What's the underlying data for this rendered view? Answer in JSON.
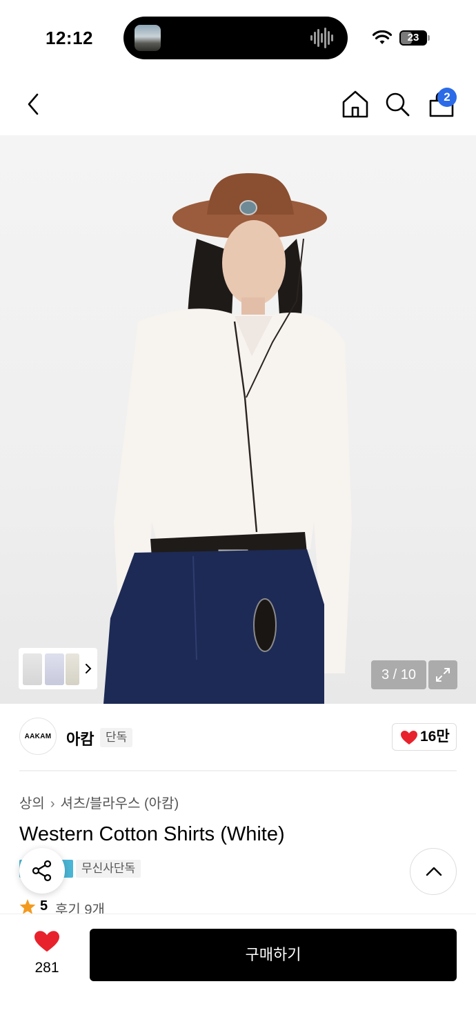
{
  "status_bar": {
    "time": "12:12",
    "battery": "23",
    "battery_level": 0.23
  },
  "nav": {
    "back_icon": "chevron-left-icon",
    "home_icon": "home-icon",
    "search_icon": "search-icon",
    "bag_icon": "shopping-bag-icon",
    "bag_count": "2",
    "badge_color": "#2b6be8"
  },
  "gallery": {
    "counter": "3 / 10",
    "expand_icon": "expand-icon",
    "current_page": 3,
    "total_pages": 10
  },
  "brand": {
    "logo_text": "AAKAM",
    "name": "아캄",
    "badge": "단독",
    "likes": "16만"
  },
  "product": {
    "breadcrumb": [
      "상의",
      "셔츠/블라우스 (아캄)"
    ],
    "title": "Western Cotton Shirts (White)",
    "exclusive_tag": "무신사단독",
    "rating": "5",
    "reviews": "후기 9개",
    "accent_color": "#4ab5d4",
    "star_color": "#f39a1e"
  },
  "bottom_bar": {
    "wish_count": "281",
    "buy_label": "구매하기",
    "heart_color": "#e8222c"
  }
}
